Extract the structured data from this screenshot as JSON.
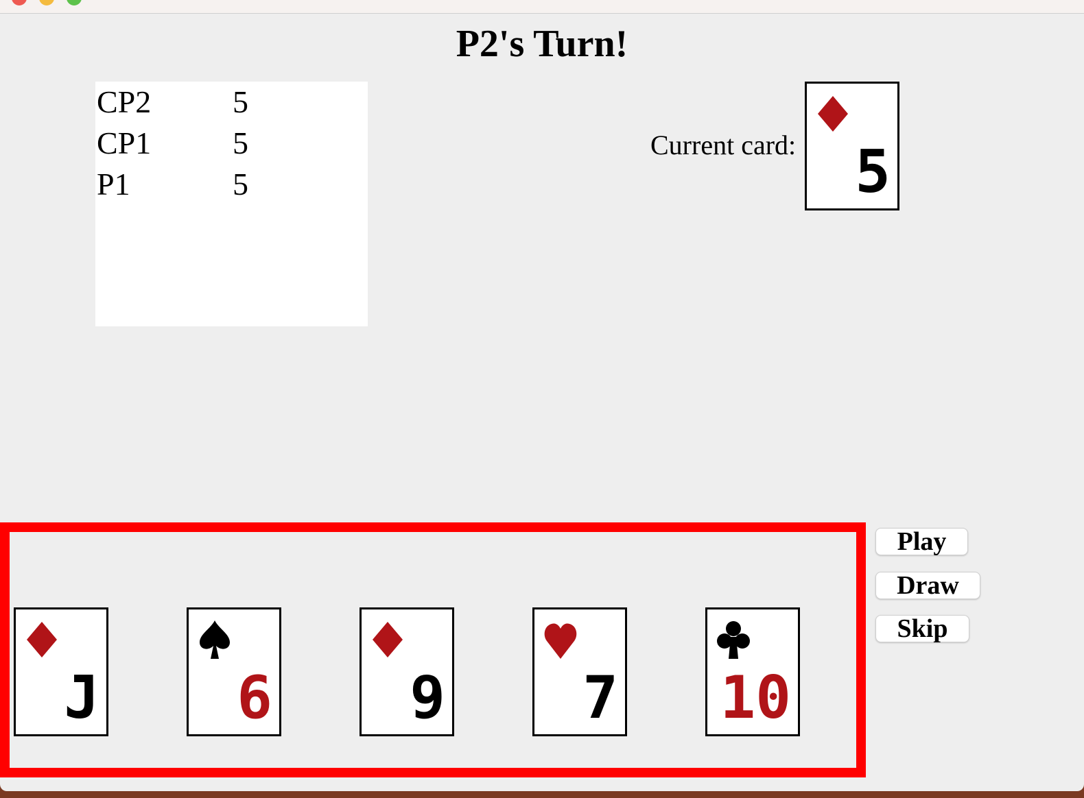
{
  "header": {
    "title": "P2's Turn!"
  },
  "scoreboard": {
    "rows": [
      {
        "player": "CP2",
        "cards": "5"
      },
      {
        "player": "CP1",
        "cards": "5"
      },
      {
        "player": "P1",
        "cards": "5"
      }
    ]
  },
  "current": {
    "label": "Current card:",
    "card": {
      "suit": "diamonds",
      "rank": "5",
      "suit_color": "#b01418",
      "rank_color": "#000000"
    }
  },
  "hand": [
    {
      "suit": "diamonds",
      "rank": "J",
      "suit_color": "#b01418",
      "rank_color": "#000000"
    },
    {
      "suit": "spades",
      "rank": "6",
      "suit_color": "#000000",
      "rank_color": "#b01418"
    },
    {
      "suit": "diamonds",
      "rank": "9",
      "suit_color": "#b01418",
      "rank_color": "#000000"
    },
    {
      "suit": "hearts",
      "rank": "7",
      "suit_color": "#b01418",
      "rank_color": "#000000"
    },
    {
      "suit": "clubs",
      "rank": "10",
      "suit_color": "#000000",
      "rank_color": "#b01418"
    }
  ],
  "controls": {
    "play": "Play",
    "draw": "Draw",
    "skip": "Skip"
  },
  "colors": {
    "hand_border": "#ff0000",
    "background": "#eeeeee"
  }
}
